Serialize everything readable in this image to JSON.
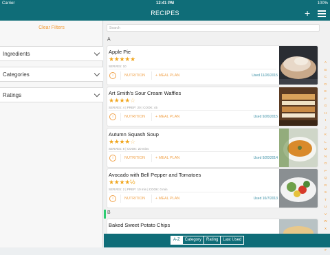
{
  "status": {
    "carrier": "Carrier",
    "time": "12:41 PM",
    "battery": "100%"
  },
  "nav": {
    "title": "RECIPES"
  },
  "filters": {
    "clear": "Clear Filters",
    "items": [
      "Ingredients",
      "Categories",
      "Ratings"
    ]
  },
  "search": {
    "placeholder": "Search"
  },
  "sections": [
    "A",
    "B"
  ],
  "recipes": [
    {
      "name": "Apple Pie",
      "stars": "★★★★★",
      "empty": "",
      "meta": "SERVES: 10",
      "used": "Used 11/26/2015",
      "rating": 5
    },
    {
      "name": "Art Smith's Sour Cream Waffles",
      "stars": "★★★★",
      "empty": "☆",
      "meta": "SERVES: 4 | PREP: 20 | COOK: 45",
      "used": "Used 9/26/2015",
      "rating": 4
    },
    {
      "name": "Autumn Squash Soup",
      "stars": "★★★★",
      "empty": "☆",
      "meta": "SERVES: 8 | COOK: 20 mins",
      "used": "Used 9/20/2014",
      "rating": 4
    },
    {
      "name": "Avocado with Bell Pepper and Tomatoes",
      "stars": "★★★★½",
      "empty": "",
      "meta": "SERVES: 2 | PREP: 10 min | COOK: 0 min",
      "used": "Used 10/7/2013",
      "rating": 4.5
    },
    {
      "name": "Baked Sweet Potato Chips",
      "stars": "",
      "empty": "",
      "meta": "",
      "used": "",
      "rating": null
    }
  ],
  "actions": {
    "info": "i",
    "nutrition": "NUTRITION",
    "meal_plan": "+ MEAL PLAN"
  },
  "alphabet": [
    "A",
    "B",
    "C",
    "D",
    "E",
    "F",
    "G",
    "H",
    "I",
    "J",
    "K",
    "L",
    "M",
    "N",
    "O",
    "P",
    "Q",
    "R",
    "S",
    "T",
    "U",
    "V",
    "W",
    "X",
    "Y",
    "Z",
    "#"
  ],
  "tabs": [
    "A-Z",
    "Category",
    "Rating",
    "Last Used"
  ],
  "colors": {
    "brand": "#0f6d78",
    "accent": "#f29a35",
    "star": "#f0a51c"
  }
}
